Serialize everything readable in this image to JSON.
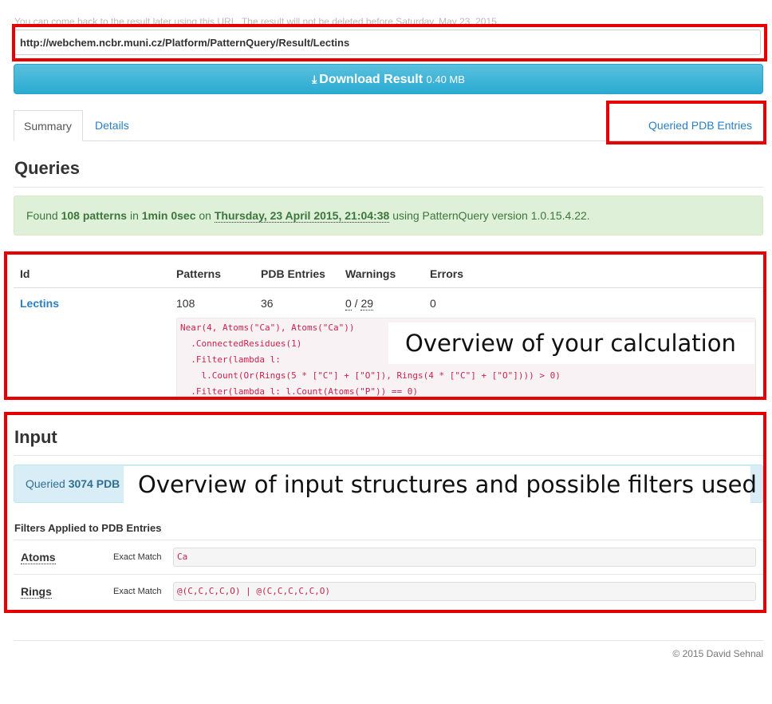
{
  "notice": "You can come back to the result later using this URL. The result will not be deleted before Saturday, May 23, 2015.",
  "result_url": "http://webchem.ncbr.muni.cz/Platform/PatternQuery/Result/Lectins",
  "download": {
    "icon": "download-icon",
    "label": "Download Result",
    "size": "0.40 MB"
  },
  "tabs": {
    "summary": "Summary",
    "details": "Details",
    "queried": "Queried PDB Entries"
  },
  "queries": {
    "heading": "Queries",
    "status": {
      "found_prefix": "Found",
      "patterns": "108 patterns",
      "in": "in",
      "duration": "1min 0sec",
      "on": "on",
      "timestamp": "Thursday, 23 April 2015, 21:04:38",
      "suffix": "using PatternQuery version 1.0.15.4.22."
    },
    "table": {
      "headers": [
        "Id",
        "Patterns",
        "PDB Entries",
        "Warnings",
        "Errors"
      ],
      "row": {
        "id": "Lectins",
        "patterns": "108",
        "pdb_entries": "36",
        "warnings": "0",
        "warnings_sep": " / ",
        "warnings_total": "29",
        "errors": "0"
      },
      "query_lines": [
        "Near(4, Atoms(\"Ca\"), Atoms(\"Ca\"))",
        "  .ConnectedResidues(1)",
        "  .Filter(lambda l:",
        "    l.Count(Or(Rings(5 * [\"C\"] + [\"O\"]), Rings(4 * [\"C\"] + [\"O\"]))) > 0)",
        "  .Filter(lambda l: l.Count(Atoms(\"P\")) == 0)"
      ]
    }
  },
  "annotations": {
    "calc": "Overview of your calculation",
    "input": "Overview of input structures and possible filters used"
  },
  "input": {
    "heading": "Input",
    "queried_prefix": "Queried",
    "queried_count": "3074 PDB",
    "filters_title": "Filters Applied to PDB Entries",
    "filters": [
      {
        "name": "Atoms",
        "mode": "Exact Match",
        "value": "Ca"
      },
      {
        "name": "Rings",
        "mode": "Exact Match",
        "value": "@(C,C,C,C,O) | @(C,C,C,C,C,O)"
      }
    ]
  },
  "footer": "© 2015 David Sehnal",
  "colors": {
    "highlight": "#e60000",
    "link": "#2a7fc1",
    "button": "#31b0d5",
    "success_bg": "#dff0d8",
    "info_bg": "#d9edf7"
  }
}
